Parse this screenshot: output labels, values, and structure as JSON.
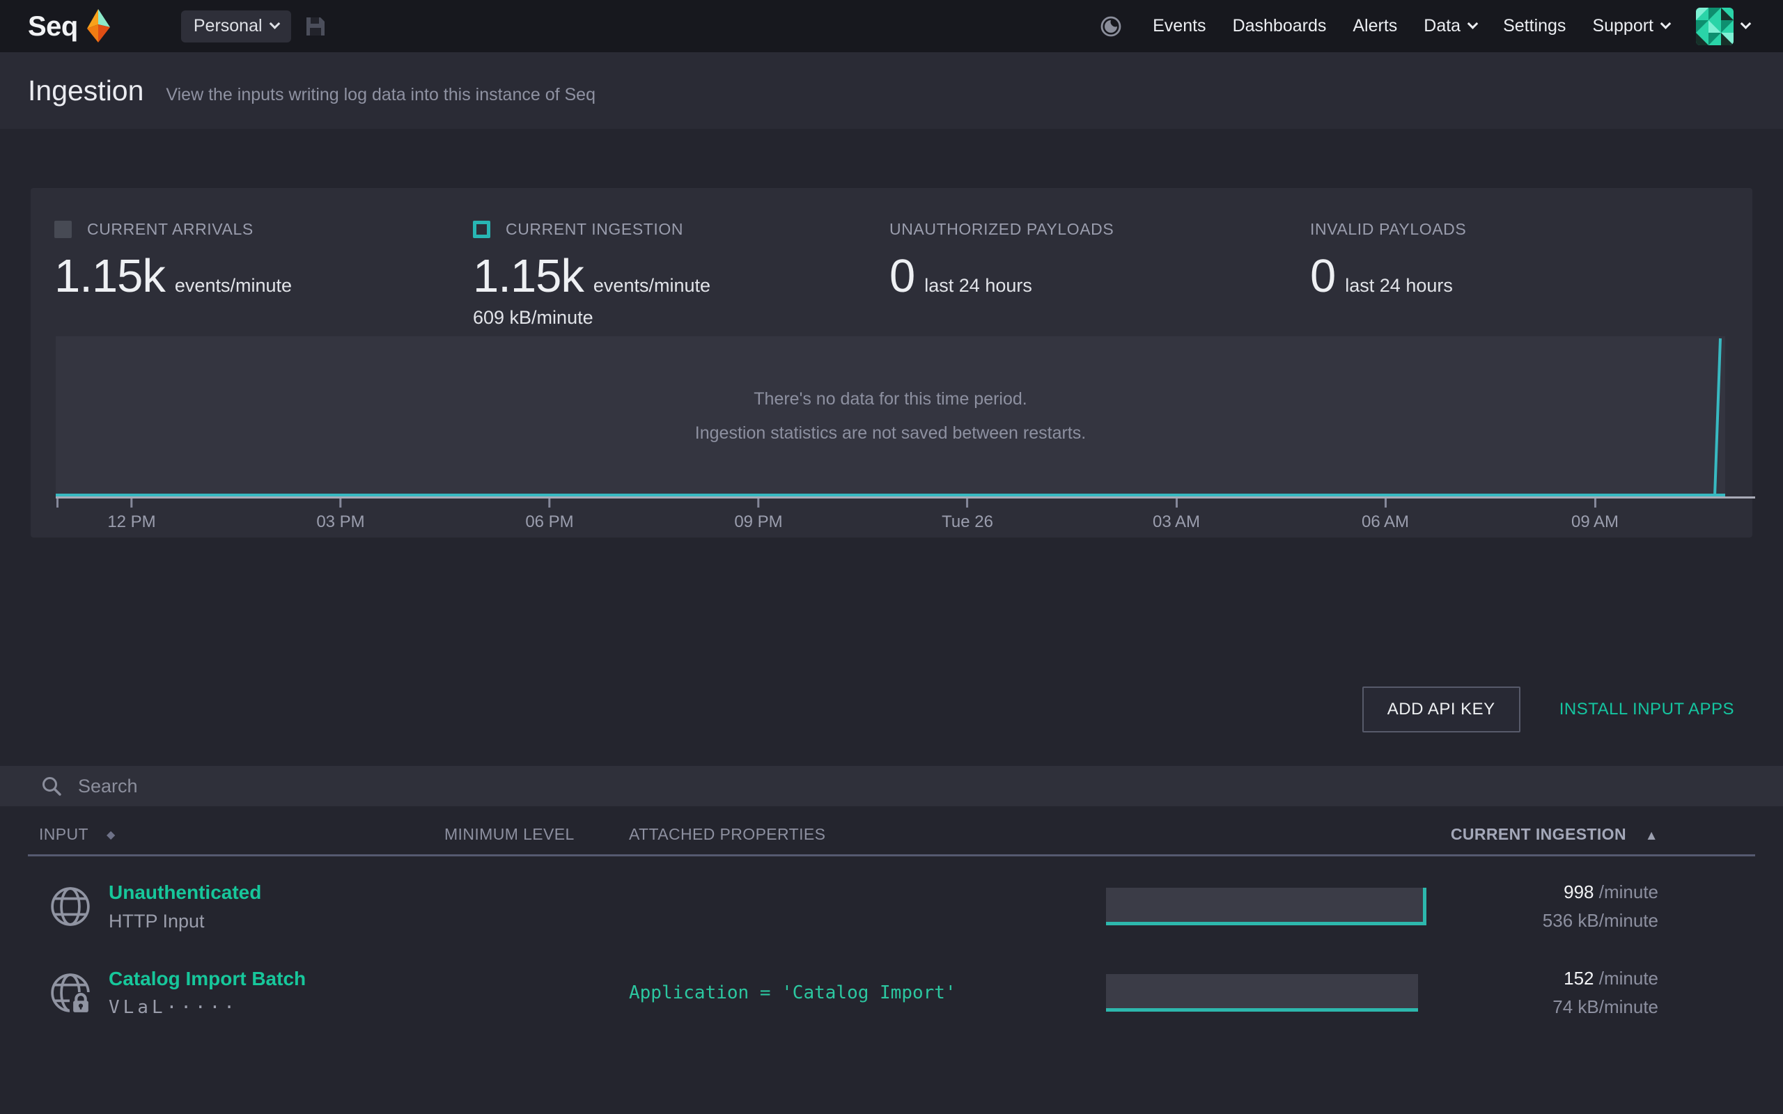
{
  "nav": {
    "brand": "Seq",
    "workspace_label": "Personal",
    "items": [
      {
        "label": "Events"
      },
      {
        "label": "Dashboards"
      },
      {
        "label": "Alerts"
      },
      {
        "label": "Data"
      },
      {
        "label": "Settings"
      },
      {
        "label": "Support"
      }
    ]
  },
  "header": {
    "title": "Ingestion",
    "subtitle": "View the inputs writing log data into this instance of Seq"
  },
  "stats": [
    {
      "label": "CURRENT ARRIVALS",
      "value": "1.15k",
      "unit": "events/minute"
    },
    {
      "label": "CURRENT INGESTION",
      "value": "1.15k",
      "unit": "events/minute",
      "secondary": "609 kB/minute"
    },
    {
      "label": "UNAUTHORIZED PAYLOADS",
      "value": "0",
      "unit": "last 24 hours"
    },
    {
      "label": "INVALID PAYLOADS",
      "value": "0",
      "unit": "last 24 hours"
    }
  ],
  "chart": {
    "empty_message_line1": "There's no data for this time period.",
    "empty_message_line2": "Ingestion statistics are not saved between restarts.",
    "ticks": [
      {
        "label": "12 PM"
      },
      {
        "label": "03 PM"
      },
      {
        "label": "06 PM"
      },
      {
        "label": "09 PM"
      },
      {
        "label": "Tue 26"
      },
      {
        "label": "03 AM"
      },
      {
        "label": "06 AM"
      },
      {
        "label": "09 AM"
      }
    ],
    "line_color": "#38b9c1",
    "has_spike_at_right_edge": true
  },
  "actions": {
    "add_api_key": "ADD API KEY",
    "install_input_apps": "INSTALL INPUT APPS"
  },
  "search": {
    "placeholder": "Search"
  },
  "table": {
    "columns": [
      {
        "label": "INPUT"
      },
      {
        "label": "MINIMUM LEVEL"
      },
      {
        "label": "ATTACHED PROPERTIES"
      },
      {
        "label": "CURRENT INGESTION"
      }
    ],
    "sort_diamond": "◆",
    "sort_asc": "▲",
    "rows": [
      {
        "name": "Unauthenticated",
        "description": "HTTP Input",
        "attached_properties": "",
        "rate": "998",
        "rate_unit": "/minute",
        "volume": "536 kB/minute"
      },
      {
        "name": "Catalog Import Batch",
        "description": "VLaL·····",
        "attached_properties": "Application = 'Catalog Import'",
        "rate": "152",
        "rate_unit": "/minute",
        "volume": "74 kB/minute"
      }
    ]
  },
  "colors": {
    "accent_teal": "#17c79b",
    "chart_teal": "#38b9c1",
    "nav_bg": "#17181e",
    "panel_bg": "#2d2e38"
  }
}
